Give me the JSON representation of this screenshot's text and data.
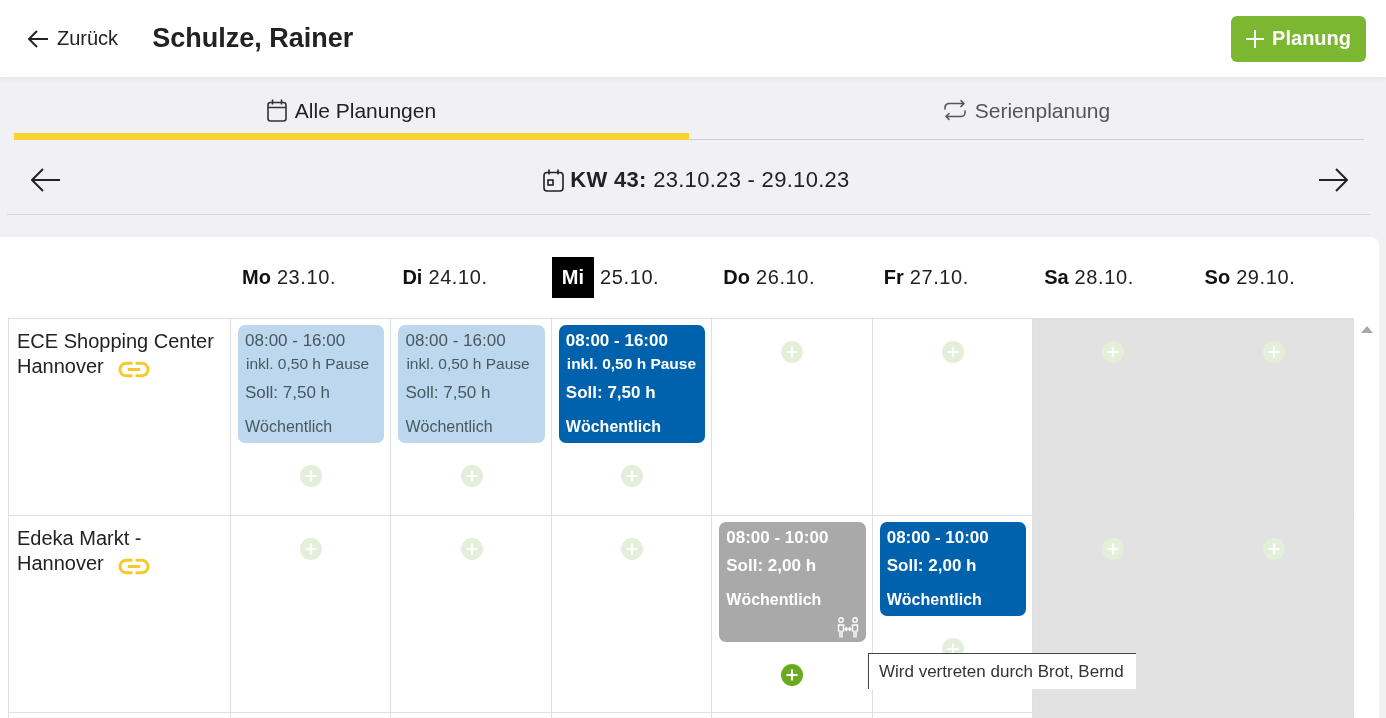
{
  "header": {
    "back_label": "Zurück",
    "title": "Schulze, Rainer",
    "add_label": "Planung"
  },
  "tabs": [
    {
      "label": "Alle Planungen",
      "kind": "overview",
      "selected": true
    },
    {
      "label": "Serienplanung",
      "kind": "series",
      "selected": false
    }
  ],
  "week": {
    "text": "**KW 43:** 23.10.23 - 29.10.23"
  },
  "days": [
    {
      "weekday": "Mo",
      "date": "23.10.",
      "today": false,
      "weekend": false
    },
    {
      "weekday": "Di",
      "date": "24.10.",
      "today": false,
      "weekend": false
    },
    {
      "weekday": "Mi",
      "date": "25.10.",
      "today": true,
      "weekend": false
    },
    {
      "weekday": "Do",
      "date": "26.10.",
      "today": false,
      "weekend": false
    },
    {
      "weekday": "Fr",
      "date": "27.10.",
      "today": false,
      "weekend": false
    },
    {
      "weekday": "Sa",
      "date": "28.10.",
      "today": false,
      "weekend": true
    },
    {
      "weekday": "So",
      "date": "29.10.",
      "today": false,
      "weekend": true
    }
  ],
  "rows": [
    {
      "location": "ECE Shopping Center Hannover",
      "linked": true,
      "cells": [
        {
          "shifts": [
            {
              "kind": "past",
              "time": "08:00 - 16:00",
              "pause": "inkl. 0,50 h Pause",
              "target": "Soll: 7,50 h",
              "recurrence": "Wöchentlich"
            }
          ],
          "add_active": false
        },
        {
          "shifts": [
            {
              "kind": "past",
              "time": "08:00 - 16:00",
              "pause": "inkl. 0,50 h Pause",
              "target": "Soll: 7,50 h",
              "recurrence": "Wöchentlich"
            }
          ],
          "add_active": false
        },
        {
          "shifts": [
            {
              "kind": "planned",
              "time": "08:00 - 16:00",
              "pause": "inkl. 0,50 h Pause",
              "target": "Soll: 7,50 h",
              "recurrence": "Wöchentlich"
            }
          ],
          "add_active": false
        },
        {
          "add_active": false
        },
        {
          "add_active": false
        },
        {
          "add_active": false
        },
        {
          "add_active": false
        }
      ]
    },
    {
      "location": "Edeka Markt - Hannover",
      "linked": true,
      "cells": [
        {
          "add_active": false
        },
        {
          "add_active": false
        },
        {
          "add_active": false
        },
        {
          "shifts": [
            {
              "kind": "substituted",
              "time": "08:00 - 10:00",
              "target": "Soll: 2,00 h",
              "recurrence": "Wöchentlich"
            }
          ],
          "add_active": true
        },
        {
          "shifts": [
            {
              "kind": "planned",
              "time": "08:00 - 10:00",
              "target": "Soll: 2,00 h",
              "recurrence": "Wöchentlich"
            }
          ],
          "add_active": false
        },
        {
          "add_active": false
        },
        {
          "add_active": false
        }
      ]
    }
  ],
  "tooltip": {
    "text": "Wird vertreten durch Brot, Bernd"
  }
}
